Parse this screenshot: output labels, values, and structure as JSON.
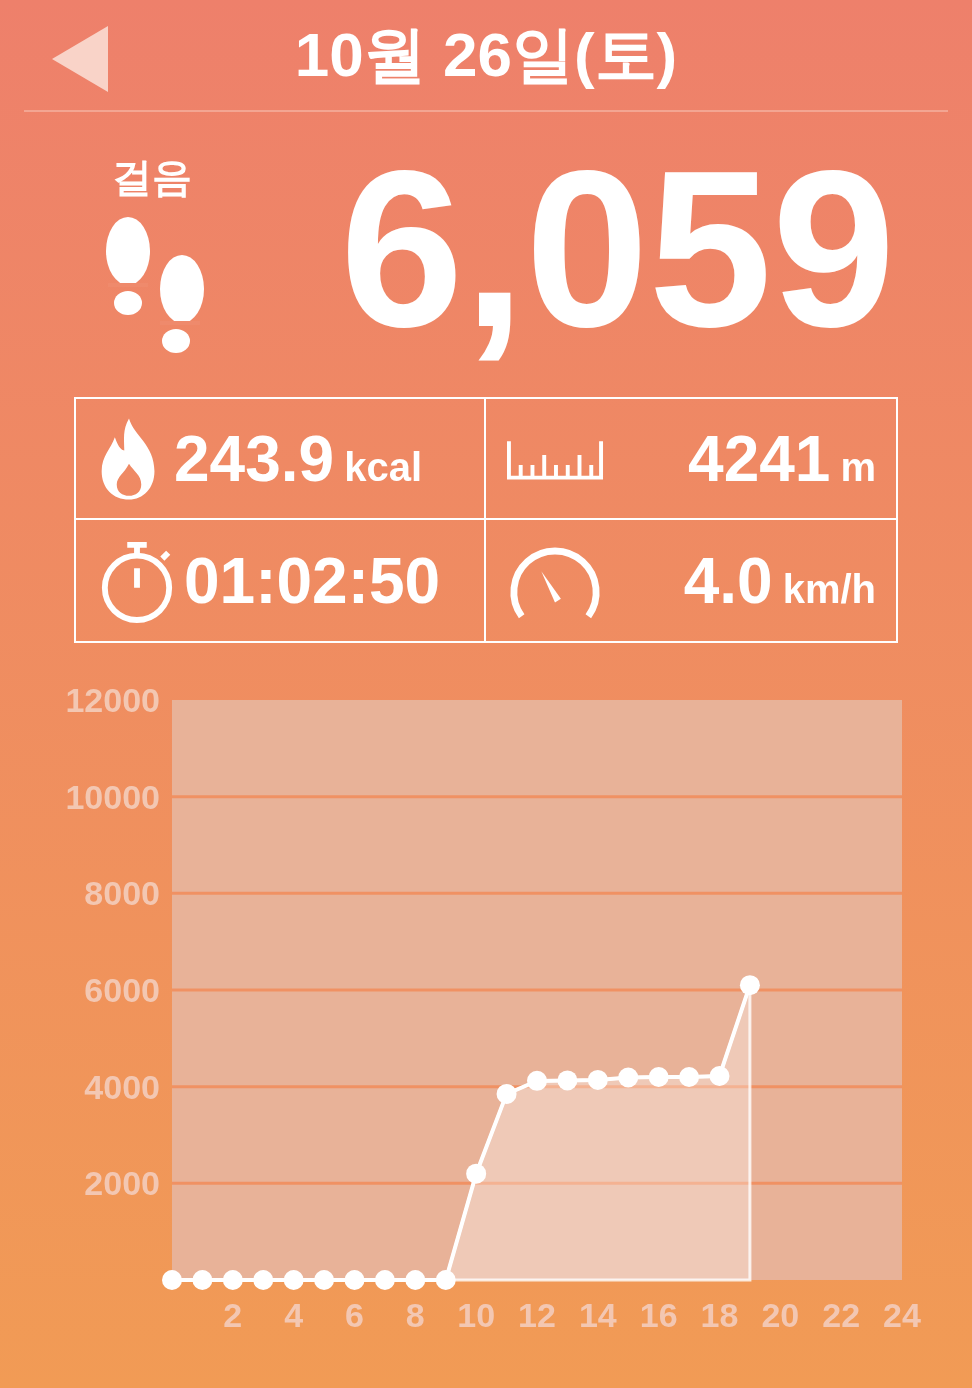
{
  "header": {
    "title": "10월 26일(토)"
  },
  "steps": {
    "label": "걸음",
    "value": "6,059"
  },
  "stats": [
    {
      "kind": "calories",
      "value": "243.9",
      "unit": "kcal"
    },
    {
      "kind": "distance",
      "value": "4241",
      "unit": "m"
    },
    {
      "kind": "time",
      "value": "01:02:50"
    },
    {
      "kind": "speed",
      "value": "4.0",
      "unit": "km/h"
    }
  ],
  "chart": {
    "chart_data": {
      "type": "area",
      "x": [
        0,
        1,
        2,
        3,
        4,
        5,
        6,
        7,
        8,
        9,
        10,
        11,
        12,
        13,
        14,
        15,
        16,
        17,
        18,
        19
      ],
      "series": [
        {
          "color": "#ffffff",
          "values": [
            0,
            0,
            0,
            0,
            0,
            0,
            0,
            0,
            0,
            0,
            2200,
            3850,
            4120,
            4130,
            4140,
            4190,
            4200,
            4200,
            4220,
            6100
          ]
        }
      ],
      "grid": true,
      "xlim": [
        0,
        24
      ],
      "ylim": [
        0,
        12000
      ],
      "xticks": [
        2,
        4,
        6,
        8,
        10,
        12,
        14,
        16,
        18,
        20,
        22,
        24
      ],
      "yticks": [
        2000,
        4000,
        6000,
        8000,
        10000,
        12000
      ]
    }
  }
}
